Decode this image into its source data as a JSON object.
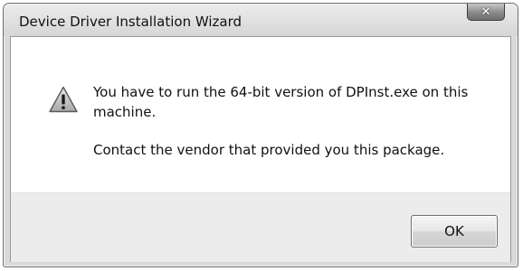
{
  "window": {
    "title": "Device Driver Installation Wizard",
    "close_icon": "close-icon"
  },
  "message": {
    "icon": "warning-icon",
    "line1": "You have to run the 64-bit version of DPInst.exe on this machine.",
    "line2": "Contact the vendor that provided you this package."
  },
  "buttons": {
    "ok_label": "OK"
  }
}
